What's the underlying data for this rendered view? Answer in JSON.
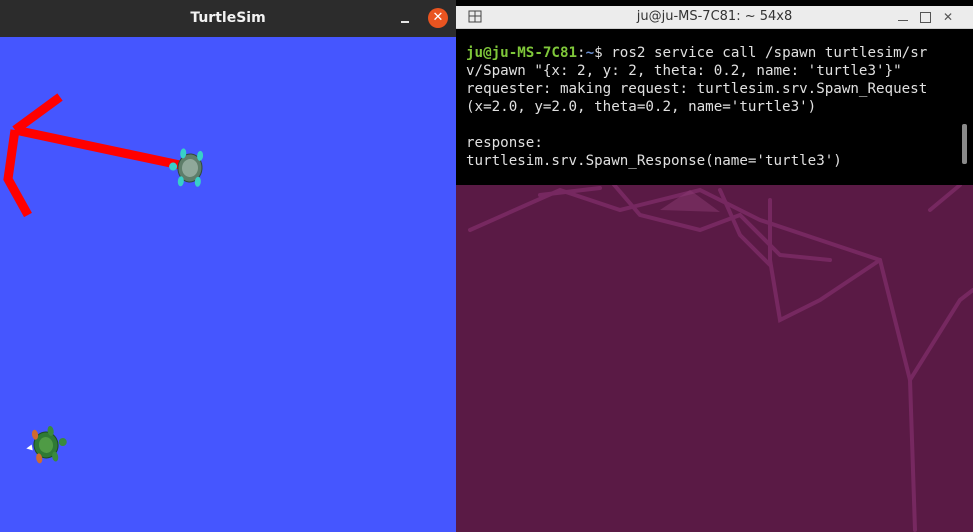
{
  "desktop": {
    "wallpaper_color": "#5a1a45"
  },
  "turtlesim": {
    "title": "TurtleSim",
    "minimize_icon": "minimize-icon",
    "close_glyph": "✕",
    "background_color": "#4556ff",
    "pen_color": "#ff0000"
  },
  "terminal": {
    "title": "ju@ju-MS-7C81: ~ 54x8",
    "prompt_user": "ju@ju-MS-7C81",
    "prompt_sep": ":",
    "prompt_path": "~",
    "prompt_symbol": "$ ",
    "command_line1": "ros2 service call /spawn turtlesim/sr",
    "command_line2": "v/Spawn \"{x: 2, y: 2, theta: 0.2, name: 'turtle3'}\"",
    "output_line1": "requester: making request: turtlesim.srv.Spawn_Request",
    "output_line2": "(x=2.0, y=2.0, theta=0.2, name='turtle3')",
    "output_blank": "",
    "output_line3": "response:",
    "output_line4": "turtlesim.srv.Spawn_Response(name='turtle3')",
    "close_glyph": "✕"
  }
}
